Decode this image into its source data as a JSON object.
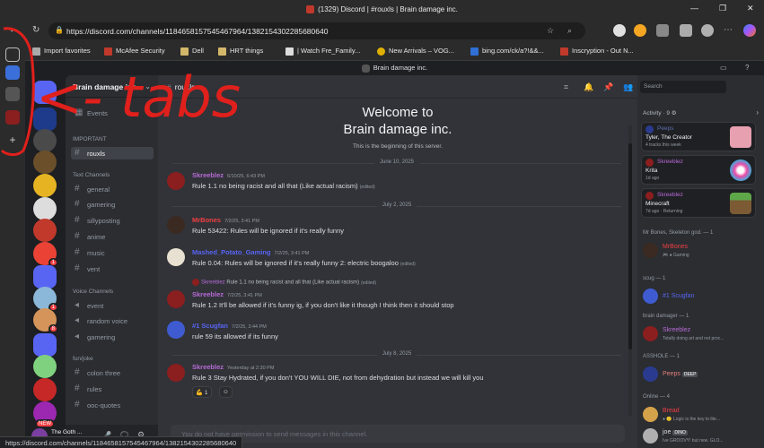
{
  "browser": {
    "window_title": "(1329) Discord | #rouxls | Brain damage inc.",
    "url": "https://discord.com/channels/1184658157545467964/1382154302285680640",
    "status_url": "https://discord.com/channels/1184658157545467964/1382154302285680640",
    "bookmarks": [
      "Import favorites",
      "McAfee Security",
      "Dell",
      "HRT things",
      "| Watch Fre_Family...",
      "New Arrivals – VOG...",
      "bing.com/ck/a?!&&...",
      "Inscryption - Out N..."
    ]
  },
  "annotation": {
    "text": "<- tabs"
  },
  "discord": {
    "top_title": "Brain damage inc.",
    "guild_name": "Brain damage inc.",
    "events_label": "Events",
    "categories": {
      "important": "IMPORTANT",
      "text": "Text Channels",
      "voice": "Voice Channels",
      "fun": "fun/joke"
    },
    "channels": {
      "rouxls": "rouxls",
      "general": "general",
      "gamering": "gamering",
      "sillyposting": "sillyposting",
      "anime": "anime",
      "music": "music",
      "vent": "vent",
      "event": "event",
      "random_voice": "random voice",
      "gamering_voice": "gamering",
      "colon_three": "colon three",
      "rules": "rules",
      "ooc_quotes": "ooc-quotes"
    },
    "user_name": "The Goth ...",
    "server_badges": {
      "s1": "1",
      "s2": "1",
      "s3": "8",
      "s4": "NEW"
    },
    "channel_header": "rouxls",
    "search_placeholder": "Search",
    "welcome_title_1": "Welcome to",
    "welcome_title_2": "Brain damage inc.",
    "welcome_sub": "This is the beginning of this server.",
    "dates": [
      "June 10, 2025",
      "July 2, 2025",
      "July 8, 2025"
    ],
    "messages": [
      {
        "author": "Skreeblez",
        "color": "#b86ad8",
        "ts": "6/10/25, 6:43 PM",
        "text": "Rule 1.1 no being racist and all that (Like actual racism)",
        "edited": "(edited)"
      },
      {
        "author": "MrBones",
        "color": "#f23f43",
        "ts": "7/2/25, 3:41 PM",
        "text": "Rule 53422: Rules will be ignored if it's really funny",
        "edited": ""
      },
      {
        "author": "Mashed_Potato_Gaming",
        "color": "#5865f2",
        "ts": "7/2/25, 3:41 PM",
        "text": "Rule 0.04: Rules will be ignored if it's really funny 2: electric boogaloo",
        "edited": "(edited)"
      },
      {
        "author": "Skreeblez",
        "color": "#b86ad8",
        "ts": "7/2/25, 3:41 PM",
        "text": "Rule 1.2 It'll be allowed if it's funny ig, if you don't like it though I think then it should stop",
        "edited": "",
        "reply_author": "Skreeblez",
        "reply_text": "Rule 1.1 no being racist and all that (Like actual racism)",
        "reply_edited": "(edited)"
      },
      {
        "author": "#1 Scugfan",
        "color": "#5865f2",
        "ts": "7/2/25, 3:44 PM",
        "text": "rule 59 its allowed if its funny",
        "edited": ""
      },
      {
        "author": "Skreeblez",
        "color": "#b86ad8",
        "ts": "Yesterday at 2:30 PM",
        "text": "Rule 3 Stay Hydrated, if you don't YOU WILL DIE, not from dehydration but instead we will kill you",
        "edited": ""
      }
    ],
    "reaction_count": "1",
    "input_placeholder": "You do not have permission to send messages in this channel.",
    "activity": {
      "title": "Activity",
      "count": "9",
      "cards": [
        {
          "name": "Peeps",
          "line1": "Tyler, The Creator",
          "line2": "4 tracks this week"
        },
        {
          "name": "Skreeblez",
          "line1": "Krita",
          "line2": "1d ago"
        },
        {
          "name": "Skreeblez",
          "line1": "Minecraft",
          "line2": "7d ago · Returning"
        }
      ]
    },
    "member_groups": [
      {
        "label": "Mr Bones, Skeleton god. — 1",
        "name": "MrBones",
        "color": "#f23f43",
        "status": "🎮 ● Gaming"
      },
      {
        "label": "scug — 1",
        "name": "#1 Scugfan",
        "color": "#5865f2",
        "status": ""
      },
      {
        "label": "brain damager — 1",
        "name": "Skreeblez",
        "color": "#b86ad8",
        "status": "Totally doing art and not proc..."
      },
      {
        "label": "ASSHOLE — 1",
        "name": "Peeps",
        "color": "#e67e7e",
        "status": "",
        "tag": "DEEP"
      },
      {
        "label": "Online — 4",
        "name": "Bread",
        "color": "#f23f43",
        "status": "● 🙂 Logic is the key to lite..."
      },
      {
        "label": "",
        "name": "joe",
        "color": "#dbdee1",
        "status": "Ive GROOVY! but new. GLO...",
        "tag": "DINO"
      }
    ]
  }
}
